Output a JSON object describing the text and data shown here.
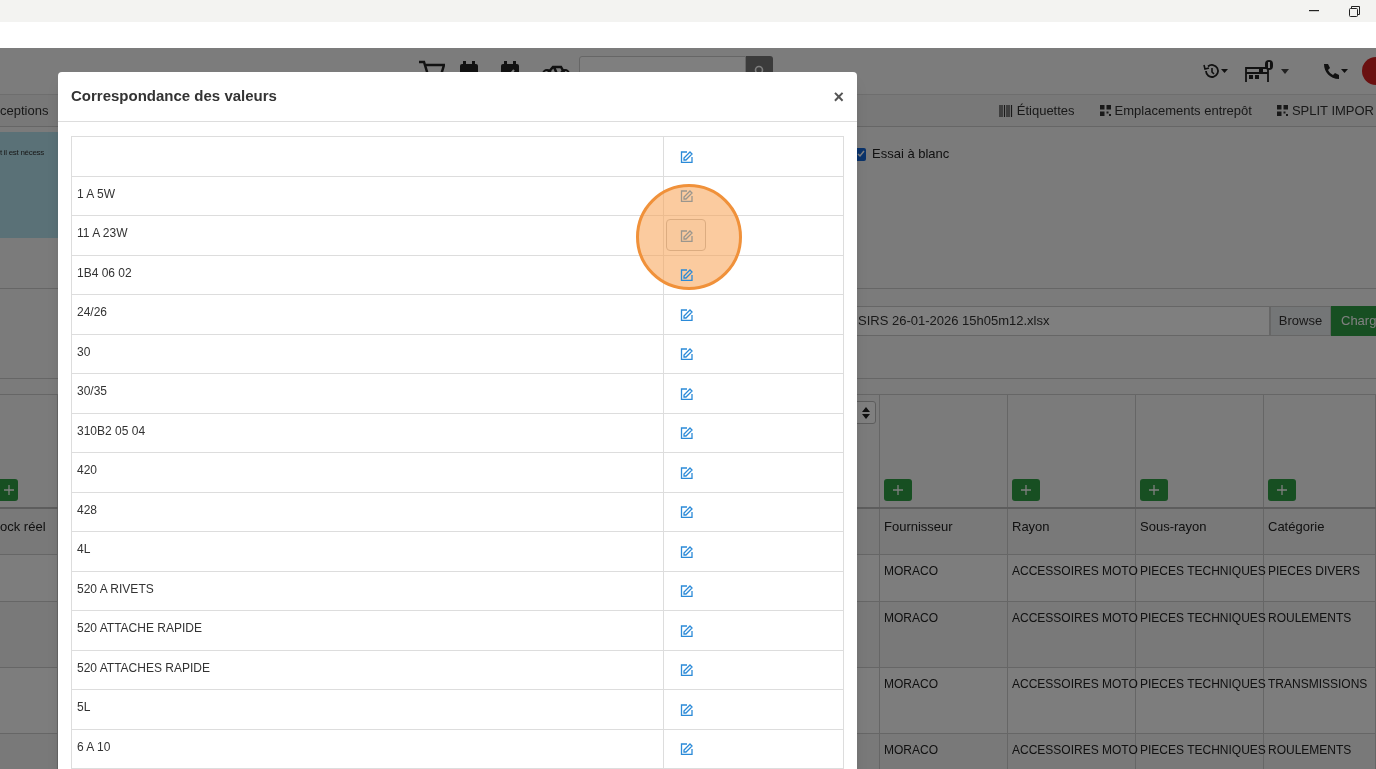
{
  "subnav": {
    "left_tab": "ceptions",
    "links": [
      {
        "label": "Étiquettes",
        "kind": "barcode"
      },
      {
        "label": "Emplacements entrepôt",
        "kind": "qr"
      },
      {
        "label": "SPLIT IMPOR",
        "kind": "qr"
      }
    ]
  },
  "notice": {
    "text": "t il est nécess"
  },
  "dry_run": {
    "label": "Essai à blanc",
    "checked": true
  },
  "file_upload": {
    "filename": "SIRS 26-01-2026 15h05m12.xlsx",
    "browse": "Browse",
    "submit": "Charg"
  },
  "table": {
    "first_column": "ock réel",
    "columns": [
      "Fournisseur",
      "Rayon",
      "Sous-rayon",
      "Catégorie"
    ],
    "rows": [
      [
        "MORACO",
        "ACCESSOIRES MOTO",
        "PIECES TECHNIQUES",
        "PIECES DIVERS"
      ],
      [
        "MORACO",
        "ACCESSOIRES MOTO",
        "PIECES TECHNIQUES",
        "ROULEMENTS"
      ],
      [
        "MORACO",
        "ACCESSOIRES MOTO",
        "PIECES TECHNIQUES",
        "TRANSMISSIONS"
      ],
      [
        "MORACO",
        "ACCESSOIRES MOTO",
        "PIECES TECHNIQUES",
        "ROULEMENTS"
      ]
    ]
  },
  "modal": {
    "title": "Correspondance des valeurs",
    "close": "×",
    "rows": [
      {
        "hovered": false
      },
      {
        "value": "1 A 5W",
        "hovered": false
      },
      {
        "value": "11 A 23W",
        "hovered": true
      },
      {
        "value": "1B4 06 02",
        "hovered": false
      },
      {
        "value": "24/26",
        "hovered": false
      },
      {
        "value": "30",
        "hovered": false
      },
      {
        "value": "30/35",
        "hovered": false
      },
      {
        "value": "310B2 05 04",
        "hovered": false
      },
      {
        "value": "420",
        "hovered": false
      },
      {
        "value": "428",
        "hovered": false
      },
      {
        "value": "4L",
        "hovered": false
      },
      {
        "value": "520 A RIVETS",
        "hovered": false
      },
      {
        "value": "520 ATTACHE RAPIDE",
        "hovered": false
      },
      {
        "value": "520 ATTACHES RAPIDE",
        "hovered": false
      },
      {
        "value": "5L",
        "hovered": false
      },
      {
        "value": "6 A 10",
        "hovered": false
      }
    ]
  }
}
